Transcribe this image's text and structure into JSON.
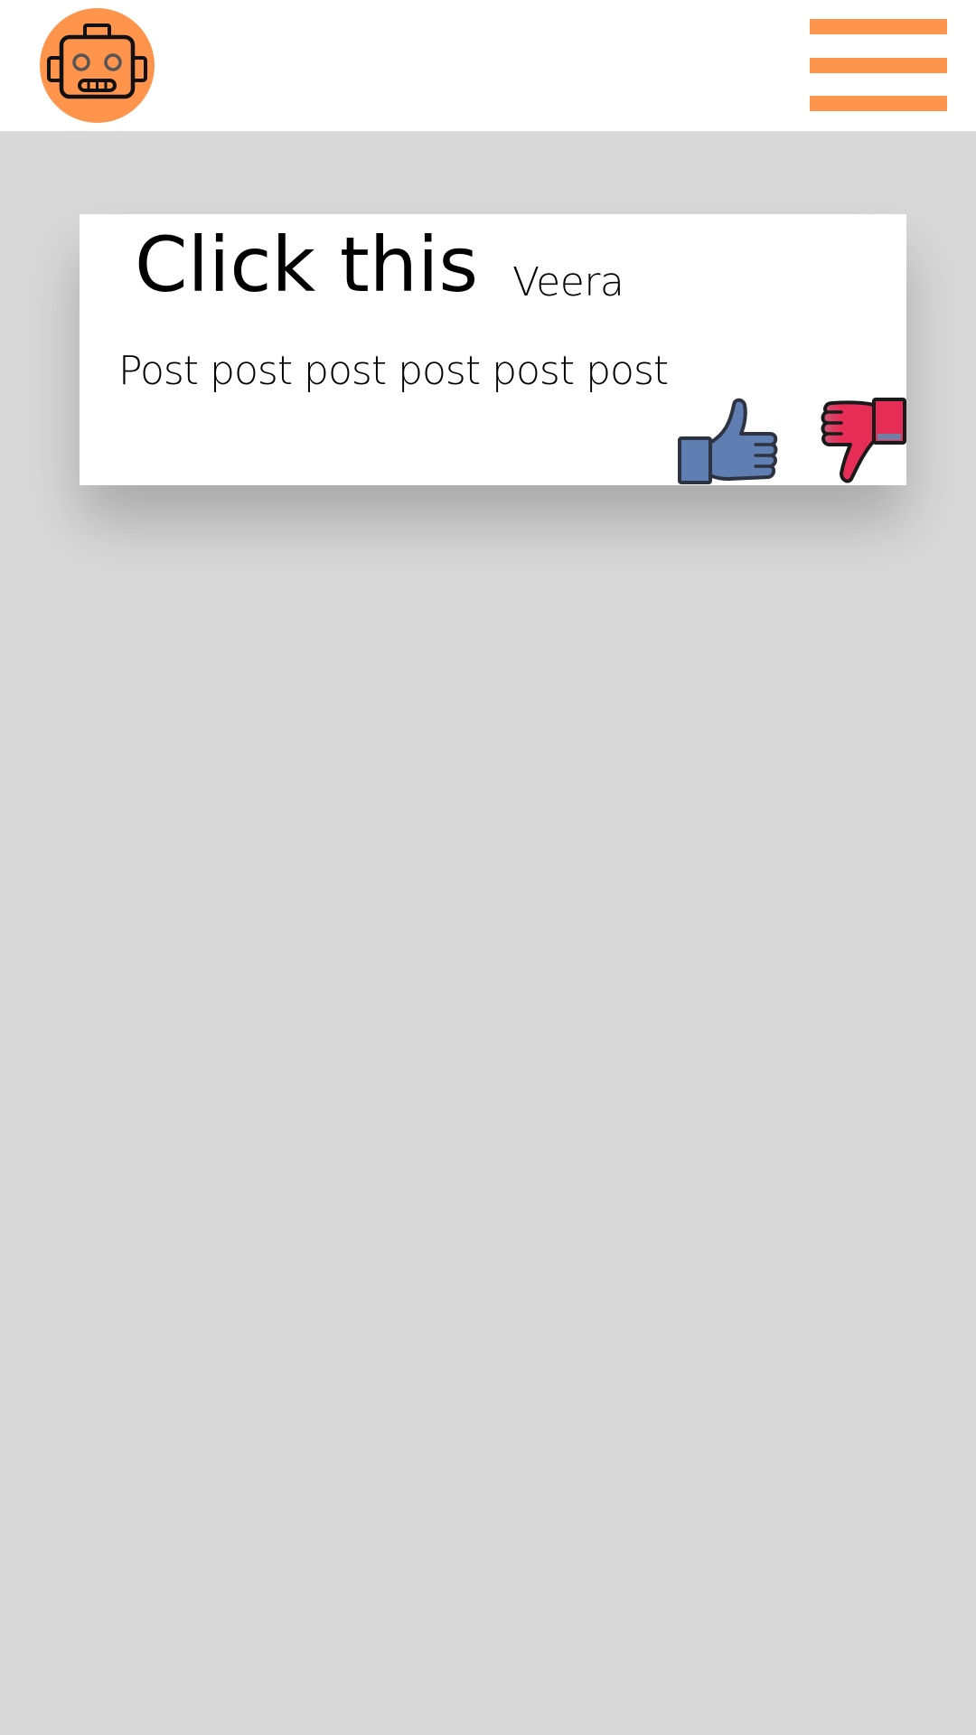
{
  "header": {
    "logo_icon": "robot-icon",
    "menu_icon": "hamburger-menu-icon"
  },
  "post": {
    "title": "Click this",
    "author": "Veera",
    "body": "Post post post post post post"
  },
  "actions": {
    "like_icon": "thumbs-up-icon",
    "dislike_icon": "thumbs-down-icon"
  },
  "colors": {
    "accent": "#ff944d",
    "background": "#d9d9d9",
    "card": "#ffffff",
    "like": "#5f7fb2",
    "dislike": "#e52d55"
  }
}
